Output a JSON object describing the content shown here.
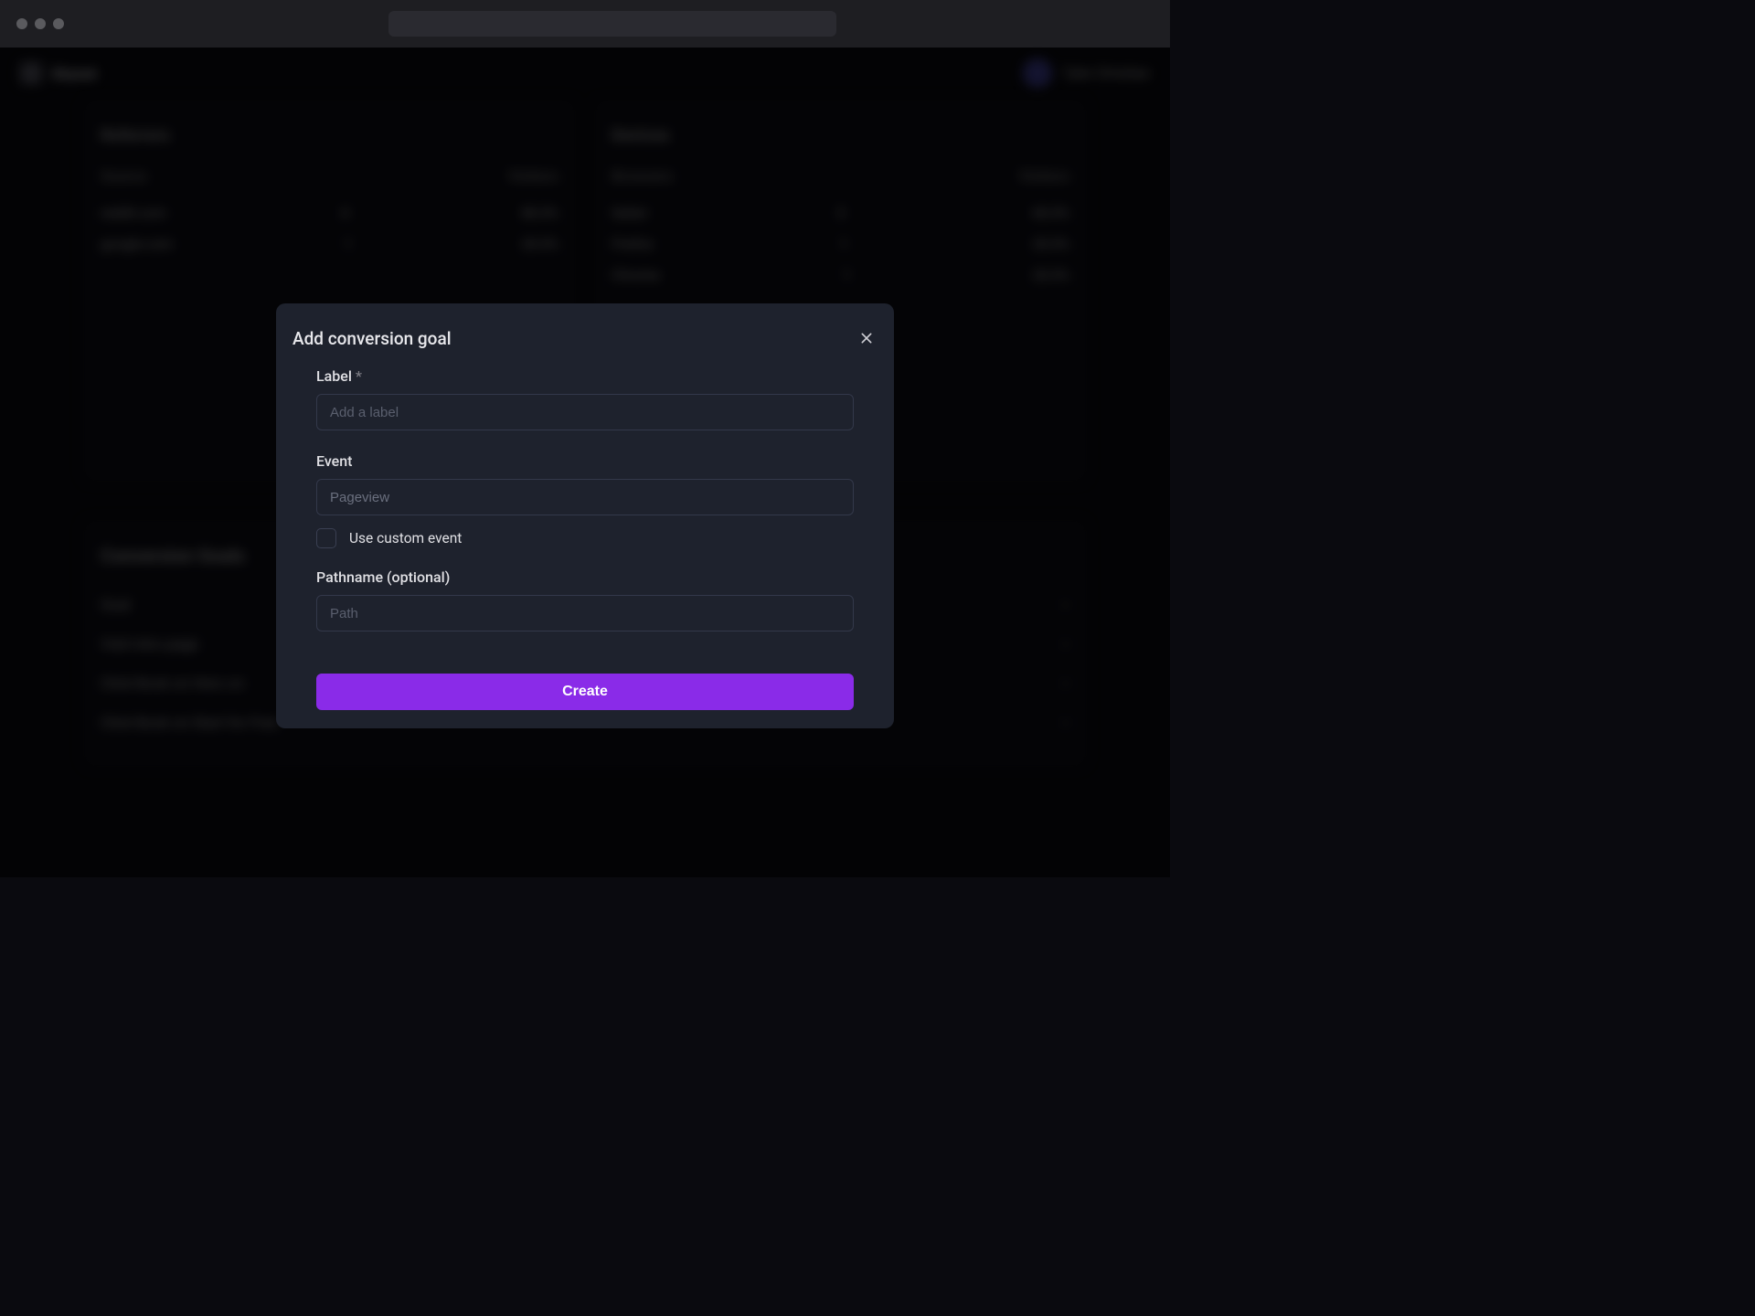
{
  "header": {
    "app_name": "Shynet",
    "user_name": "Tyler Christian"
  },
  "panels": {
    "left": {
      "title": "Referrers",
      "col1": "Source",
      "col2": "Visitors",
      "rows": [
        {
          "label": "reddit.com",
          "count": "4",
          "pct": "80.0%"
        },
        {
          "label": "google.com",
          "count": "1",
          "pct": "20.0%"
        }
      ]
    },
    "right": {
      "title": "Devices",
      "col1": "Browsers",
      "col2": "Visitors",
      "rows": [
        {
          "label": "Safari",
          "count": "3",
          "pct": "60.0%"
        },
        {
          "label": "Firefox",
          "count": "1",
          "pct": "20.0%"
        },
        {
          "label": "Chrome",
          "count": "1",
          "pct": "20.0%"
        }
      ]
    }
  },
  "goals_panel": {
    "title": "Conversion Goals",
    "col1": "Goal",
    "rows": [
      "Visit intro page",
      "Click Book on Hero on",
      "Click Book on Start for Free"
    ]
  },
  "modal": {
    "title": "Add conversion goal",
    "label_field": {
      "label": "Label",
      "required_mark": "*",
      "placeholder": "Add a label"
    },
    "event_field": {
      "label": "Event",
      "value": "Pageview"
    },
    "checkbox": {
      "label": "Use custom event"
    },
    "pathname_field": {
      "label": "Pathname (optional)",
      "placeholder": "Path"
    },
    "create_button": "Create"
  }
}
